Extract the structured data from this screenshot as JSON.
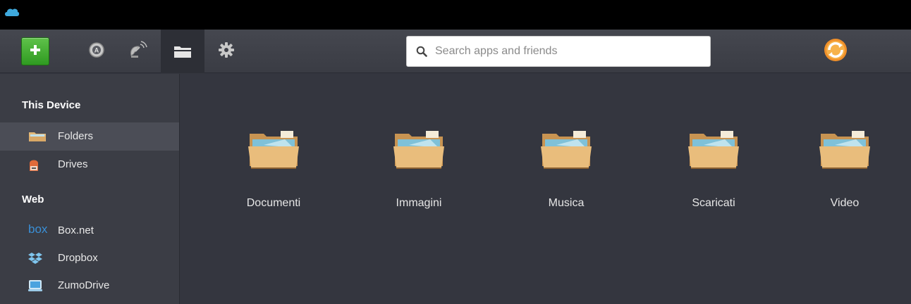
{
  "titlebar": {
    "app_icon": "cloud-icon"
  },
  "toolbar": {
    "buttons": [
      {
        "name": "add-icon"
      },
      {
        "name": "apps-icon"
      },
      {
        "name": "satellite-icon"
      },
      {
        "name": "folders-icon",
        "active": true
      },
      {
        "name": "gear-icon"
      }
    ],
    "accent_add": "#3aa52a",
    "sync_icon": "sync-icon",
    "sync_color": "#f0902a"
  },
  "search": {
    "placeholder": "Search apps and friends",
    "value": ""
  },
  "sidebar": {
    "sections": [
      {
        "title": "This Device",
        "items": [
          {
            "label": "Folders",
            "icon": "folder-icon",
            "selected": true
          },
          {
            "label": "Drives",
            "icon": "drive-icon",
            "selected": false
          }
        ]
      },
      {
        "title": "Web",
        "items": [
          {
            "label": "Box.net",
            "icon": "box-icon",
            "icon_text": "box",
            "selected": false
          },
          {
            "label": "Dropbox",
            "icon": "dropbox-icon",
            "selected": false
          },
          {
            "label": "ZumoDrive",
            "icon": "zumodrive-icon",
            "selected": false
          }
        ]
      }
    ]
  },
  "folders": [
    {
      "name": "Documenti",
      "icon": "folder-icon"
    },
    {
      "name": "Immagini",
      "icon": "folder-icon"
    },
    {
      "name": "Musica",
      "icon": "folder-icon"
    },
    {
      "name": "Scaricati",
      "icon": "folder-icon"
    },
    {
      "name": "Video",
      "icon": "folder-icon"
    }
  ]
}
